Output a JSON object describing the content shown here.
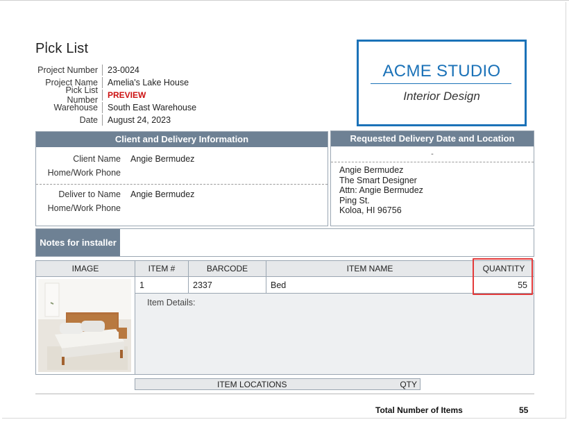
{
  "title": "Pick List",
  "info": [
    {
      "label": "Project Number",
      "value": "23-0024"
    },
    {
      "label": "Project Name",
      "value": "Amelia's Lake House"
    },
    {
      "label": "Pick List Number",
      "value": "PREVIEW"
    },
    {
      "label": "Warehouse",
      "value": "South East Warehouse"
    },
    {
      "label": "Date",
      "value": "August 24, 2023"
    }
  ],
  "logo": {
    "name": "ACME STUDIO",
    "subtitle": "Interior Design",
    "color": "#1b72b8"
  },
  "client_panel": {
    "heading": "Client and Delivery Information",
    "client_name_label": "Client Name",
    "client_name": "Angie Bermudez",
    "phone_label_1": "Home/Work Phone",
    "deliver_to_label": "Deliver to Name",
    "deliver_to": "Angie Bermudez",
    "phone_label_2": "Home/Work Phone"
  },
  "delivery_panel": {
    "heading": "Requested Delivery Date and Location",
    "date": "-",
    "address": [
      "Angie Bermudez",
      "The Smart Designer",
      "Attn: Angie Bermudez",
      "Ping St.",
      "Koloa, HI 96756"
    ]
  },
  "notes": {
    "label": "Notes for installer"
  },
  "table": {
    "headers": [
      "IMAGE",
      "ITEM #",
      "BARCODE",
      "ITEM NAME",
      "QUANTITY"
    ],
    "row": {
      "item_no": "1",
      "barcode": "2337",
      "item_name": "Bed",
      "quantity": "55"
    },
    "details_label": "Item Details:"
  },
  "locations": {
    "title": "ITEM LOCATIONS",
    "qty": "QTY"
  },
  "total": {
    "label": "Total Number of Items",
    "value": "55"
  },
  "colors": {
    "header_bg": "#6e8194",
    "highlight": "#e33a3a",
    "preview": "#cc1111"
  }
}
